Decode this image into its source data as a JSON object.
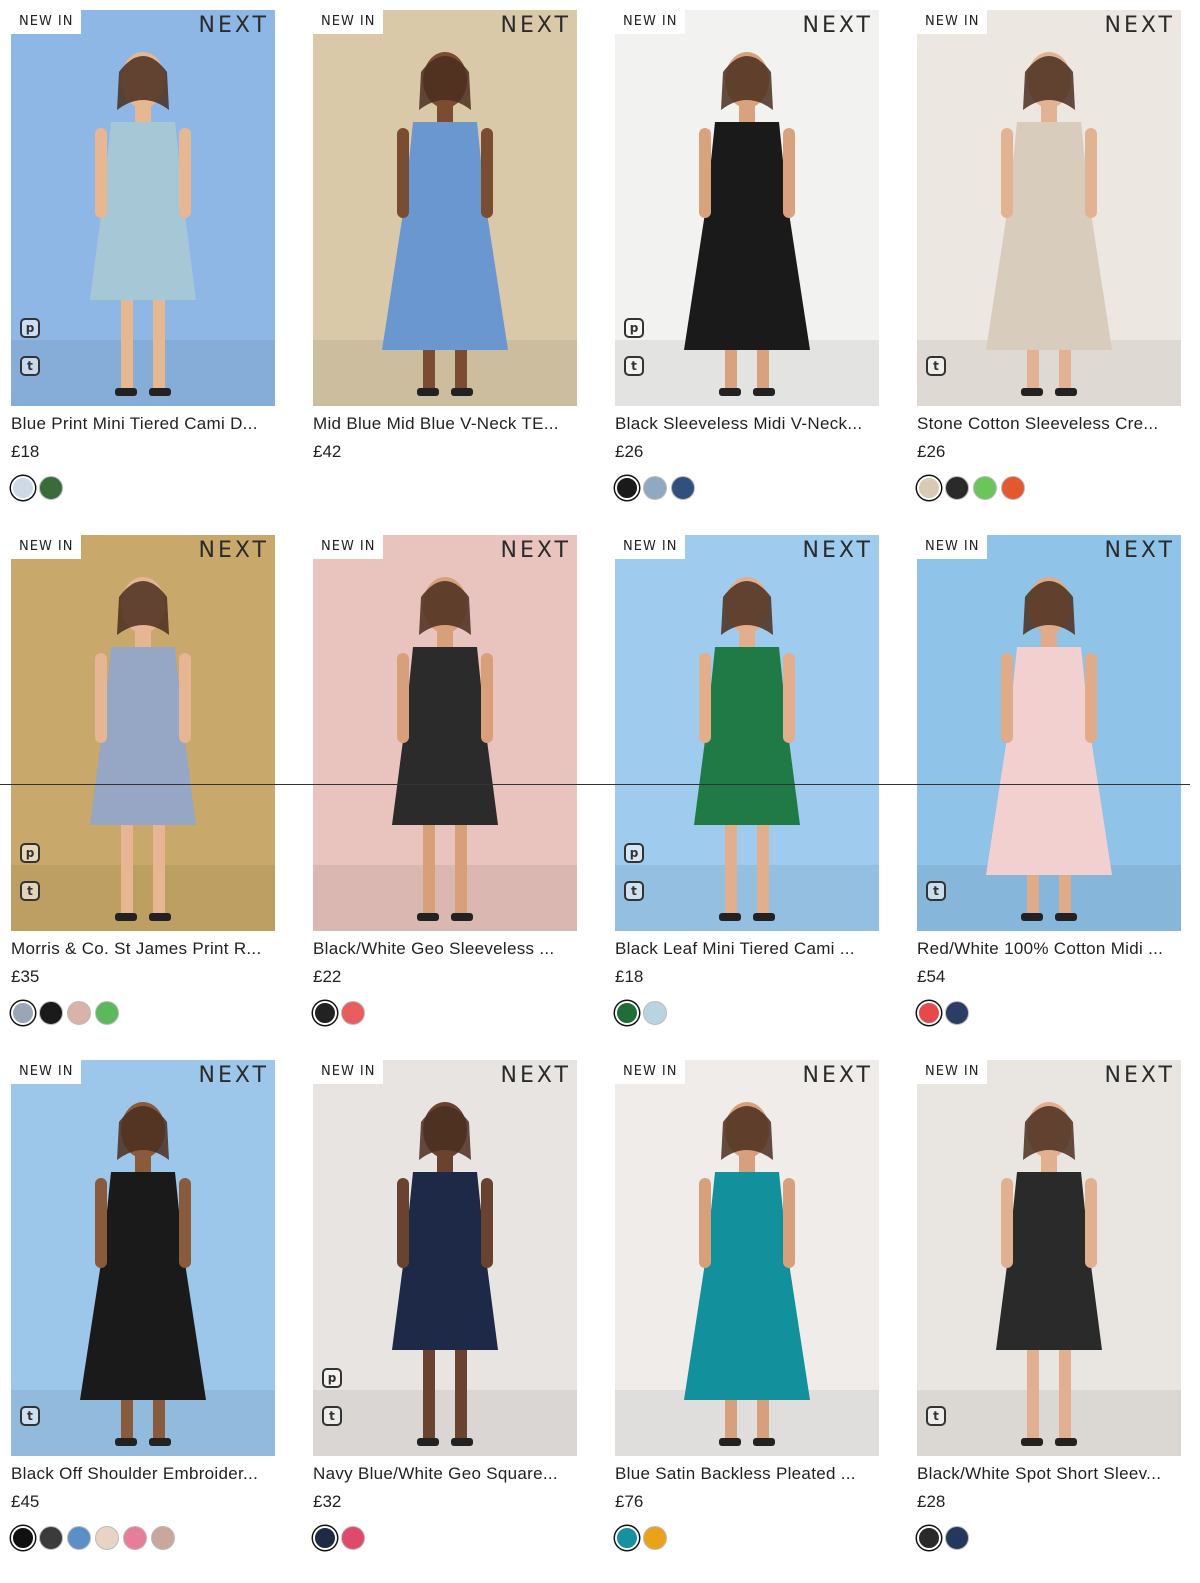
{
  "badge": "NEW IN",
  "brand": "NEXT",
  "icons": {
    "pay_icon": "p",
    "tag_icon": "t"
  },
  "products": [
    {
      "title": "Blue Print Mini Tiered Cami D...",
      "price": "£18",
      "swatches": [
        "#cfd9e6",
        "#3a6b3a"
      ],
      "icons": [
        "p",
        "t"
      ],
      "bg": "#8fb7e6",
      "dress": "#a6c7d6"
    },
    {
      "title": "Mid Blue Mid Blue V-Neck TE...",
      "price": "£42",
      "swatches": [],
      "icons": [],
      "bg": "#d9c9a8",
      "dress": "#6a97cf"
    },
    {
      "title": "Black Sleeveless Midi V-Neck...",
      "price": "£26",
      "swatches": [
        "#1a1a1a",
        "#8fa9c2",
        "#32507e"
      ],
      "icons": [
        "p",
        "t"
      ],
      "bg": "#f2f2f0",
      "dress": "#1a1a1a"
    },
    {
      "title": "Stone Cotton Sleeveless Cre...",
      "price": "£26",
      "swatches": [
        "#d8cab5",
        "#2a2a2a",
        "#6bc55a",
        "#e4582f"
      ],
      "icons": [
        "t"
      ],
      "bg": "#ece7e1",
      "dress": "#d8cdbd"
    },
    {
      "title": "Morris & Co. St James Print R...",
      "price": "£35",
      "swatches": [
        "#9aa6b8",
        "#1a1a1a",
        "#d9b3a8",
        "#5bb95b"
      ],
      "icons": [
        "p",
        "t"
      ],
      "bg": "#c9a96b",
      "dress": "#95a7c4"
    },
    {
      "title": "Black/White Geo Sleeveless ...",
      "price": "£22",
      "swatches": [
        "#222222",
        "#e85d5d"
      ],
      "icons": [],
      "bg": "#e9c3bd",
      "dress": "#2b2b2b"
    },
    {
      "title": "Black Leaf Mini Tiered Cami ...",
      "price": "£18",
      "swatches": [
        "#1f6e3a",
        "#b9d3e0"
      ],
      "icons": [
        "p",
        "t"
      ],
      "bg": "#9fcbee",
      "dress": "#1f7a46"
    },
    {
      "title": "Red/White 100% Cotton Midi ...",
      "price": "£54",
      "swatches": [
        "#e44a4a",
        "#2b3d66"
      ],
      "icons": [
        "t"
      ],
      "bg": "#8fc3e8",
      "dress": "#f2d0cf"
    },
    {
      "title": "Black Off Shoulder Embroider...",
      "price": "£45",
      "swatches": [
        "#111111",
        "#3b3b3b",
        "#5c8fc8",
        "#e8d3c4",
        "#e87d9a",
        "#caa69b"
      ],
      "icons": [
        "t"
      ],
      "bg": "#9cc6ea",
      "dress": "#1a1a1a"
    },
    {
      "title": "Navy Blue/White Geo Square...",
      "price": "£32",
      "swatches": [
        "#1f2a44",
        "#e04a6a"
      ],
      "icons": [
        "p",
        "t"
      ],
      "bg": "#e7e4e1",
      "dress": "#1e2847"
    },
    {
      "title": "Blue Satin Backless Pleated ...",
      "price": "£76",
      "swatches": [
        "#1591a0",
        "#e9a31a"
      ],
      "icons": [],
      "bg": "#efecea",
      "dress": "#12919d"
    },
    {
      "title": "Black/White Spot Short Sleev...",
      "price": "£28",
      "swatches": [
        "#2a2a2a",
        "#24385c"
      ],
      "icons": [
        "t"
      ],
      "bg": "#e9e6e2",
      "dress": "#2a2a2a"
    }
  ]
}
